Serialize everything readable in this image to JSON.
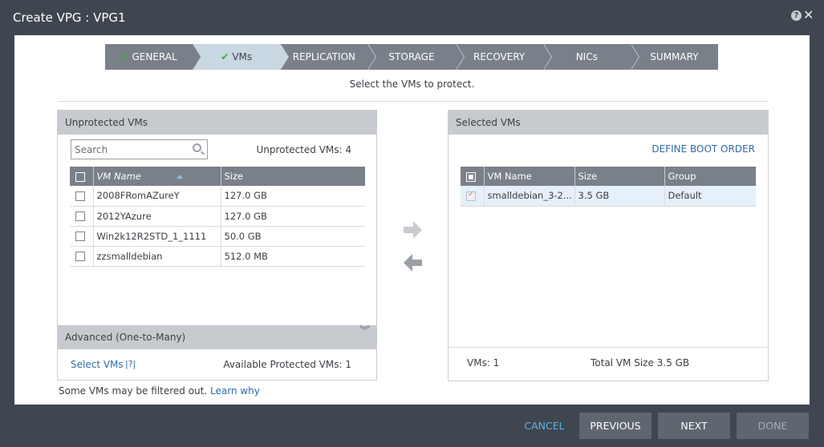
{
  "window": {
    "title": "Create VPG : VPG1"
  },
  "steps": [
    {
      "label": "GENERAL",
      "done": true
    },
    {
      "label": "VMs",
      "done": true
    },
    {
      "label": "REPLICATION"
    },
    {
      "label": "STORAGE"
    },
    {
      "label": "RECOVERY"
    },
    {
      "label": "NICs"
    },
    {
      "label": "SUMMARY"
    }
  ],
  "subtitle": "Select the VMs to protect.",
  "unprotected": {
    "header": "Unprotected VMs",
    "search_placeholder": "Search",
    "count_text": "Unprotected VMs: 4",
    "columns": {
      "name": "VM Name",
      "size": "Size"
    },
    "rows": [
      {
        "name": "2008FRomAZureY",
        "size": "127.0 GB"
      },
      {
        "name": "2012YAzure",
        "size": "127.0 GB"
      },
      {
        "name": "Win2k12R2STD_1_1111",
        "size": "50.0 GB"
      },
      {
        "name": "zzsmalldebian",
        "size": "512.0 MB"
      }
    ],
    "advanced_label": "Advanced (One-to-Many)",
    "select_vms": "Select VMs",
    "help_link": "|?|",
    "available_text": "Available Protected VMs: 1"
  },
  "selected": {
    "header": "Selected VMs",
    "define_boot_order": "DEFINE BOOT ORDER",
    "columns": {
      "name": "VM Name",
      "size": "Size",
      "group": "Group"
    },
    "rows": [
      {
        "name": "smalldebian_3-2...",
        "size": "3.5 GB",
        "group": "Default"
      }
    ],
    "vms_count": "VMs: 1",
    "total_size": "Total VM Size 3.5 GB"
  },
  "filter_note": "Some VMs may be filtered out.",
  "learn_why": "Learn why",
  "buttons": {
    "cancel": "CANCEL",
    "previous": "PREVIOUS",
    "next": "NEXT",
    "done": "DONE"
  },
  "colors": {
    "accent_link": "#2d6ba5",
    "step_bg": "#7a8089",
    "step_active": "#c9d7e2",
    "check": "#3aaa35"
  }
}
